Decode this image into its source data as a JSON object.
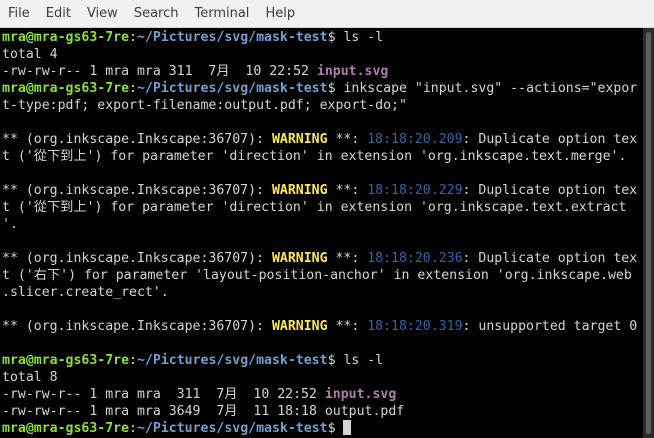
{
  "menubar": {
    "items": [
      "File",
      "Edit",
      "View",
      "Search",
      "Terminal",
      "Help"
    ]
  },
  "prompt": {
    "user": "mra@mra-gs63-7re",
    "path": "~/Pictures/svg/mask-test"
  },
  "lines": [
    {
      "cmd": " ls -l"
    },
    {
      "text": "total 4"
    },
    {
      "ls_prefix": "-rw-rw-r-- 1 mra mra 311  7月  10 22:52 ",
      "file": "input.svg"
    },
    {
      "cmd": " inkscape \"input.svg\" --actions=\"expor"
    },
    {
      "text": "t-type:pdf; export-filename:output.pdf; export-do;\""
    },
    {
      "text": ""
    },
    {
      "w_pre": "** (org.inkscape.Inkscape:36707): ",
      "w_label": "WARNING",
      "w_mid": " **: ",
      "w_ts": "18:18:20.209",
      "w_post": ": Duplicate option tex"
    },
    {
      "text": "t ('從下到上') for parameter 'direction' in extension 'org.inkscape.text.merge'."
    },
    {
      "text": ""
    },
    {
      "w_pre": "** (org.inkscape.Inkscape:36707): ",
      "w_label": "WARNING",
      "w_mid": " **: ",
      "w_ts": "18:18:20.229",
      "w_post": ": Duplicate option tex"
    },
    {
      "text": "t ('從下到上') for parameter 'direction' in extension 'org.inkscape.text.extract"
    },
    {
      "text": "'."
    },
    {
      "text": ""
    },
    {
      "w_pre": "** (org.inkscape.Inkscape:36707): ",
      "w_label": "WARNING",
      "w_mid": " **: ",
      "w_ts": "18:18:20.236",
      "w_post": ": Duplicate option tex"
    },
    {
      "text": "t ('右下') for parameter 'layout-position-anchor' in extension 'org.inkscape.web"
    },
    {
      "text": ".slicer.create_rect'."
    },
    {
      "text": ""
    },
    {
      "w_pre": "** (org.inkscape.Inkscape:36707): ",
      "w_label": "WARNING",
      "w_mid": " **: ",
      "w_ts": "18:18:20.319",
      "w_post": ": unsupported target 0"
    },
    {
      "text": ""
    },
    {
      "cmd": " ls -l"
    },
    {
      "text": "total 8"
    },
    {
      "ls_prefix": "-rw-rw-r-- 1 mra mra  311  7月  10 22:52 ",
      "file_bold": "input.svg"
    },
    {
      "text": "-rw-rw-r-- 1 mra mra 3649  7月  11 18:18 output.pdf"
    },
    {
      "cmd": " ",
      "cursor": true
    }
  ],
  "colors": {
    "user": "#8ae234",
    "path": "#729fcf",
    "warning": "#fce94f",
    "timestamp": "#3465a4",
    "svgfile": "#ad7fa8",
    "text": "#d3d7cf",
    "background": "#000000"
  }
}
